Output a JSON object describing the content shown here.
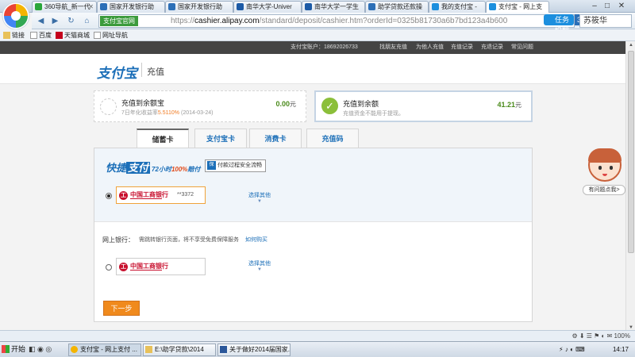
{
  "browser": {
    "tabs": [
      {
        "label": "360导航_新一代",
        "favicon_color": "#2aa63a"
      },
      {
        "label": "国家开发银行助",
        "favicon_color": "#2c6fb7"
      },
      {
        "label": "国家开发银行助",
        "favicon_color": "#2c6fb7"
      },
      {
        "label": "南华大学-Univer",
        "favicon_color": "#1c5aa6"
      },
      {
        "label": "南华大学一学生",
        "favicon_color": "#1c5aa6"
      },
      {
        "label": "助学贷款还款操",
        "favicon_color": "#2c6fb7"
      },
      {
        "label": "我的支付宝 -",
        "favicon_color": "#1c8fde"
      },
      {
        "label": "支付宝 - 网上支",
        "favicon_color": "#1c8fde"
      }
    ],
    "window_controls": {
      "minimize": "–",
      "maximize": "□",
      "close": "✕"
    },
    "site_identity": "支付宝官网",
    "url_host": "cashier.alipay.com",
    "url_prefix": "https://",
    "url_rest": "/standard/deposit/cashier.htm?orderId=0325b81730a6b7bd123a4b600",
    "task_badge": "任务提醒",
    "task_count": "3",
    "search_text": "苏筱华",
    "bookmarks": [
      "链接",
      "百度",
      "天猫商城",
      "网址导航"
    ]
  },
  "topbar": {
    "account_label": "支付宝账户：18692026733",
    "links": [
      "找朋友充值",
      "为他人充值",
      "充值记录",
      "充退记录",
      "常见问题"
    ]
  },
  "header": {
    "brand": "支付宝",
    "section": "充值"
  },
  "cards": [
    {
      "title": "充值到余额宝",
      "sub_prefix": "7日年化收益率",
      "rate": "5.5110%",
      "sub_suffix": "(2014-03-24)",
      "amount": "0.00",
      "unit": "元"
    },
    {
      "title": "充值到余额",
      "sub": "充值资金不能用于提现。",
      "amount": "41.21",
      "unit": "元"
    }
  ],
  "tabs": [
    "储蓄卡",
    "支付宝卡",
    "消费卡",
    "充值码"
  ],
  "quickpay": {
    "logo_a": "快捷",
    "logo_b": "支付",
    "slogan_a": "72小时",
    "slogan_b": "100%",
    "slogan_c": "赔付",
    "secure_btn": "付款过程安全流畅"
  },
  "banks": {
    "quick_bank": "中国工商银行",
    "card_no": "**3372",
    "choose_other": "选择其他",
    "net_label": "网上银行：",
    "net_note": "需跳转银行页面，将不享受免费保障服务",
    "net_link": "如何购买",
    "net_bank": "中国工商银行",
    "choose_other_2": "选择其他"
  },
  "next_button": "下一步",
  "helper": {
    "question": "有问题点我>"
  },
  "taskbar": {
    "start": "开始",
    "tasks": [
      "支付宝 - 网上支付 ...",
      "E:\\助学贷款\\2014",
      "关于做好2014届国家..."
    ],
    "clock": "14:17"
  }
}
